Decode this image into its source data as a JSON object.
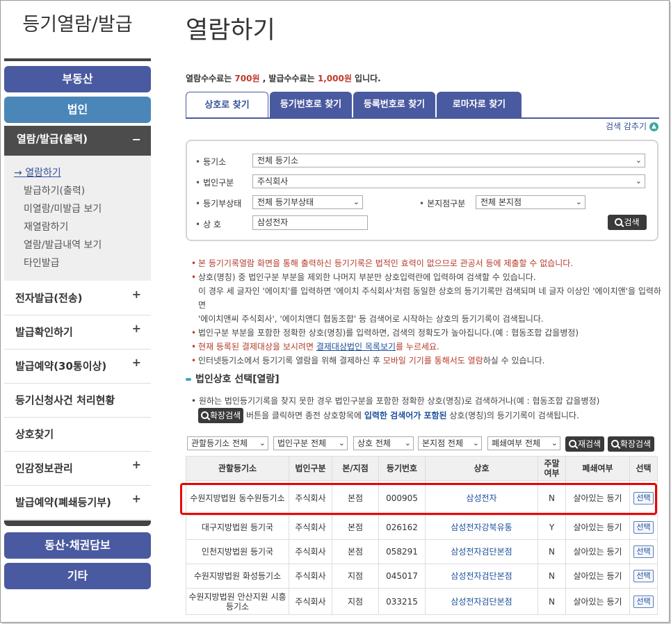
{
  "sidebar": {
    "title": "등기열람/발급",
    "nav": {
      "real_estate": "부동산",
      "corporation": "법인",
      "view_issue": "열람/발급(출력)",
      "view_issue_toggle": "−"
    },
    "sub_items": [
      "열람하기",
      "발급하기(출력)",
      "미열람/미발급 보기",
      "재열람하기",
      "열람/발급내역 보기",
      "타인발급"
    ],
    "sub_active_marker": "→",
    "menu_rows": [
      {
        "label": "전자발급(전송)",
        "icon": "+"
      },
      {
        "label": "발급확인하기",
        "icon": "+"
      },
      {
        "label": "발급예약(30통이상)",
        "icon": "+"
      },
      {
        "label": "등기신청사건 처리현황",
        "icon": ""
      },
      {
        "label": "상호찾기",
        "icon": ""
      },
      {
        "label": "인감정보관리",
        "icon": "+"
      },
      {
        "label": "발급예약(폐쇄등기부)",
        "icon": "+"
      }
    ],
    "bottom_nav": {
      "movable": "동산·채권담보",
      "other": "기타"
    }
  },
  "main": {
    "title": "열람하기",
    "fee": {
      "part1": "열람수수료는 ",
      "view_fee": "700원",
      "part2": " , 발급수수료는 ",
      "issue_fee": "1,000원",
      "part3": " 입니다."
    },
    "tabs": [
      "상호로 찾기",
      "등기번호로 찾기",
      "등록번호로 찾기",
      "로마자로 찾기"
    ],
    "hide_search": "검색 감추기",
    "search": {
      "registry_label": "등기소",
      "registry_value": "전체 등기소",
      "corp_type_label": "법인구분",
      "corp_type_value": "주식회사",
      "status_label": "등기부상태",
      "status_value": "전체 등기부상태",
      "branch_label": "본지점구분",
      "branch_value": "전체 본지점",
      "name_label": "상 호",
      "name_value": "삼성전자",
      "search_button": "검색"
    },
    "notices": {
      "n1": "본 등기기록열람 화면을 통해 출력하신 등기기록은 법적인 효력이 없으므로 관공서 등에 제출할 수 없습니다.",
      "n2": "상호(명칭) 중 법인구분 부분을 제외한 나머지 부분만 상호입력란에 입력하여 검색할 수 있습니다.",
      "n2b": "이 경우 세 글자인 '에이치'를 입력하면 '에이치 주식회사'처럼 동일한 상호의 등기기록만 검색되며 네 글자 이상인 '에이치앤'을 입력하면",
      "n2c": "'에이치앤씨 주식회사', '에이치앤디 협동조합' 등 검색어로 시작하는 상호의 등기기록이 검색됩니다.",
      "n3": "법인구분 부분을 포함한 정확한 상호(명칭)를 입력하면, 검색의 정확도가 높아집니다.(예 : 협동조합 갑을병정)",
      "n4a": "현재 등록된 결제대상을 보시려면 ",
      "n4link": "결제대상법인 목록보기",
      "n4b": "를 누르세요.",
      "n5a": "인터넷등기소에서 등기기록 열람을 위해 결제하신 후 ",
      "n5hi": "모바일 기기를 통해서도 열람",
      "n5b": "하실 수 있습니다."
    },
    "section_title": "법인상호 선택[열람]",
    "info": {
      "line1": "원하는 법인등기기록을 찾지 못한 경우 법인구분을 포함한 정확한 상호(명칭)로 검색하거나(예 : 협동조합 갑을병정)",
      "ext_button": "확장검색",
      "line2a": " 버튼을 클릭하면 종전 상호항목에 ",
      "line2hi": "입력한 검색어가 포함된",
      "line2b": " 상호(명칭)의 등기기록이 검색됩니다."
    },
    "filters": {
      "registry": "관할등기소 전체",
      "corp_type": "법인구분 전체",
      "name": "상호 전체",
      "branch": "본지점 전체",
      "closed": "폐쇄여부 전체",
      "research_button": "재검색",
      "ext_button": "확장검색"
    },
    "table": {
      "headers": [
        "관할등기소",
        "법인구분",
        "본/지점",
        "등기번호",
        "상호",
        "주말\n여부",
        "폐쇄여부",
        "선택"
      ],
      "rows": [
        {
          "registry": "수원지방법원 동수원등기소",
          "type": "주식회사",
          "branch": "본점",
          "number": "000905",
          "name": "삼성전자",
          "weekend": "N",
          "closed": "살아있는 등기",
          "select": "선택"
        },
        {
          "registry": "대구지방법원 등기국",
          "type": "주식회사",
          "branch": "본점",
          "number": "026162",
          "name": "삼성전자강북유통",
          "weekend": "Y",
          "closed": "살아있는 등기",
          "select": "선택"
        },
        {
          "registry": "인천지방법원 등기국",
          "type": "주식회사",
          "branch": "본점",
          "number": "058291",
          "name": "삼성전자검단본점",
          "weekend": "N",
          "closed": "살아있는 등기",
          "select": "선택"
        },
        {
          "registry": "수원지방법원 화성등기소",
          "type": "주식회사",
          "branch": "지점",
          "number": "045017",
          "name": "삼성전자검단본점",
          "weekend": "N",
          "closed": "살아있는 등기",
          "select": "선택"
        },
        {
          "registry": "수원지방법원 안산지원 시흥등기소",
          "type": "주식회사",
          "branch": "지점",
          "number": "033215",
          "name": "삼성전자검단본점",
          "weekend": "N",
          "closed": "살아있는 등기",
          "select": "선택"
        }
      ]
    }
  },
  "colors": {
    "brand_blue": "#4a5aa0",
    "sky_blue": "#4b86b8",
    "dark_gray": "#4c4c4c",
    "accent_red": "#c0392b",
    "highlight_border": "#e00000"
  }
}
